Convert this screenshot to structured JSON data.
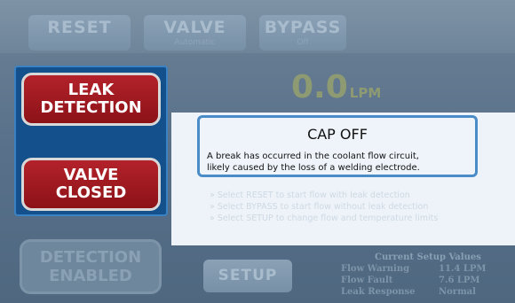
{
  "top_buttons": {
    "reset": {
      "label": "RESET",
      "sub": ""
    },
    "valve": {
      "label": "VALVE",
      "sub": "Automatic"
    },
    "bypass": {
      "label": "BYPASS",
      "sub": "Off"
    }
  },
  "left_panel": {
    "leak_detection": {
      "line1": "LEAK",
      "line2": "DETECTION"
    },
    "valve_closed": {
      "line1": "VALVE",
      "line2": "CLOSED"
    },
    "detection_enabled": {
      "line1": "DETECTION",
      "line2": "ENABLED"
    }
  },
  "flow": {
    "value": "0.0",
    "unit": "LPM"
  },
  "alert": {
    "title": "CAP OFF",
    "line1": "A break has occurred in the coolant flow circuit,",
    "line2": "likely caused by the loss of a welding electrode."
  },
  "hints": [
    "» Select RESET to start flow with leak detection",
    "» Select BYPASS to start flow without leak detection",
    "» Select SETUP to change flow and temperature limits"
  ],
  "setup": {
    "button_label": "SETUP",
    "header": "Current Setup Values",
    "rows": [
      {
        "key": "Flow Warning",
        "value": "11.4 LPM"
      },
      {
        "key": "Flow Fault",
        "value": "7.6 LPM"
      },
      {
        "key": "Leak Response",
        "value": "Normal"
      }
    ]
  }
}
